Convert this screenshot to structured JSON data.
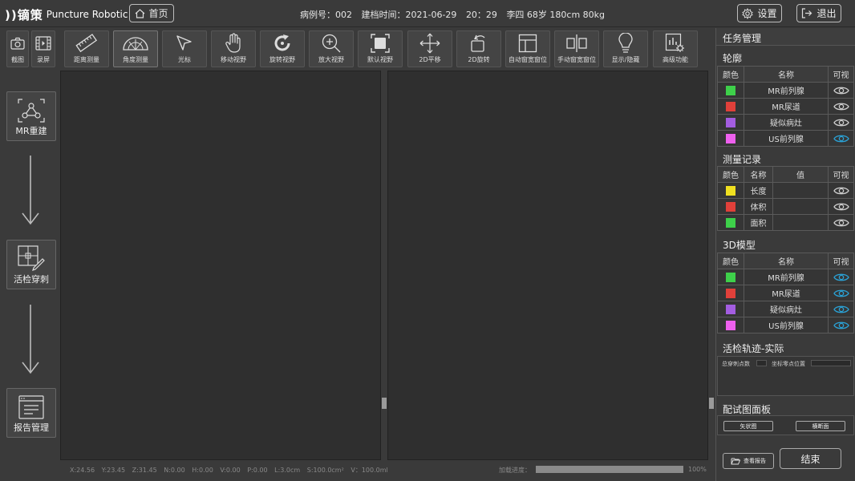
{
  "header": {
    "logo_mark": "))镝策",
    "logo_text": "Puncture Robotic",
    "home_label": "首页",
    "case_no": "病例号：002",
    "created": "建档时间：2021-06-29",
    "time": "20：29",
    "patient": "李四 68岁 180cm 80kg",
    "settings_label": "设置",
    "exit_label": "退出"
  },
  "toolbar": {
    "screenshot": "截图",
    "record": "录屏",
    "distance": "距离测量",
    "angle": "角度测量",
    "cursor": "光标",
    "move": "移动视野",
    "rotate": "旋转视野",
    "zoom": "放大视野",
    "default": "默认视野",
    "pan2d": "2D平移",
    "rotate2d": "2D旋转",
    "auto_window": "自动窗宽窗位",
    "manual_window": "手动窗宽窗位",
    "show_hide": "显示/隐藏",
    "advanced": "高级功能"
  },
  "left": {
    "mr": "MR重建",
    "biopsy": "活检穿刺",
    "report": "报告管理"
  },
  "status": {
    "x": "X:24.56",
    "y": "Y:23.45",
    "z": "Z:31.45",
    "n": "N:0.00",
    "h": "H:0.00",
    "v": "V:0.00",
    "p": "P:0.00",
    "l": "L:3.0cm",
    "s": "S:100.0cm²",
    "vol": "V：100.0ml",
    "load_label": "加载进度：",
    "load_pct": "100%",
    "load_fraction": 1.0
  },
  "panel": {
    "title": "任务管理",
    "contour_title": "轮廓",
    "contour_headers": [
      "颜色",
      "名称",
      "可视"
    ],
    "contours": [
      {
        "color": "#3ed04a",
        "name": "MR前列腺",
        "visible": false
      },
      {
        "color": "#e0403a",
        "name": "MR尿道",
        "visible": false
      },
      {
        "color": "#a35de0",
        "name": "疑似病灶",
        "visible": false
      },
      {
        "color": "#ee60ee",
        "name": "US前列腺",
        "visible": true
      }
    ],
    "measure_title": "测量记录",
    "measure_headers": [
      "颜色",
      "名称",
      "值",
      "可视"
    ],
    "measures": [
      {
        "color": "#f0e020",
        "name": "长度",
        "value": ""
      },
      {
        "color": "#e0403a",
        "name": "体积",
        "value": ""
      },
      {
        "color": "#3ed04a",
        "name": "面积",
        "value": ""
      }
    ],
    "model_title": "3D模型",
    "model_headers": [
      "颜色",
      "名称",
      "可视"
    ],
    "models": [
      {
        "color": "#3ed04a",
        "name": "MR前列腺",
        "visible": true
      },
      {
        "color": "#e0403a",
        "name": "MR尿道",
        "visible": true
      },
      {
        "color": "#a35de0",
        "name": "疑似病灶",
        "visible": true
      },
      {
        "color": "#ee60ee",
        "name": "US前列腺",
        "visible": true
      }
    ],
    "traj_title": "活检轨迹-实际",
    "traj_total": "总穿刺点数",
    "traj_zero": "坐标零点位置",
    "fit_title": "配试图面板",
    "sagittal": "矢状图",
    "transverse": "横断面",
    "view_report": "查看报告",
    "end": "结束"
  }
}
